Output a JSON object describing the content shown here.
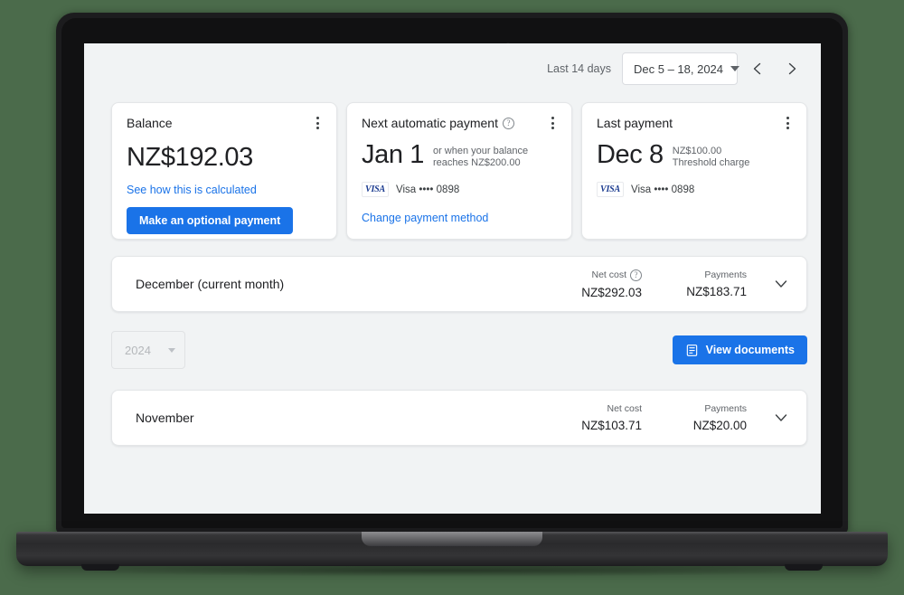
{
  "header": {
    "range_label": "Last 14 days",
    "date_range": "Dec 5 – 18, 2024",
    "prev_icon": "chevron-left-icon",
    "next_icon": "chevron-right-icon",
    "dropdown_icon": "caret-down-icon"
  },
  "cards": {
    "balance": {
      "title": "Balance",
      "amount": "NZ$192.03",
      "link": "See how this is calculated",
      "button": "Make an optional payment",
      "menu_icon": "more-vert-icon"
    },
    "next_payment": {
      "title": "Next automatic payment",
      "title_help_icon": "help-circle-icon",
      "date": "Jan 1",
      "note_line1": "or when your balance",
      "note_line2": "reaches NZ$200.00",
      "card_brand": "VISA",
      "card_text": "Visa •••• 0898",
      "link": "Change payment method",
      "menu_icon": "more-vert-icon"
    },
    "last_payment": {
      "title": "Last payment",
      "date": "Dec 8",
      "note_line1": "NZ$100.00",
      "note_line2": "Threshold charge",
      "card_brand": "VISA",
      "card_text": "Visa •••• 0898",
      "menu_icon": "more-vert-icon"
    }
  },
  "months": [
    {
      "name": "December (current month)",
      "net_cost_label": "Net cost",
      "net_cost_help_icon": "help-circle-icon",
      "net_cost_value": "NZ$292.03",
      "payments_label": "Payments",
      "payments_value": "NZ$183.71",
      "expand_icon": "chevron-down-icon"
    },
    {
      "name": "November",
      "net_cost_label": "Net cost",
      "net_cost_value": "NZ$103.71",
      "payments_label": "Payments",
      "payments_value": "NZ$20.00",
      "expand_icon": "chevron-down-icon"
    }
  ],
  "controls": {
    "year": "2024",
    "year_caret_icon": "caret-down-icon",
    "view_documents": "View documents",
    "view_documents_icon": "document-icon"
  },
  "colors": {
    "accent": "#1a73e8",
    "page_bg": "#f1f3f4",
    "card_bg": "#ffffff",
    "text_primary": "#202124",
    "text_secondary": "#5f6368",
    "backdrop": "#4b6b4b"
  }
}
